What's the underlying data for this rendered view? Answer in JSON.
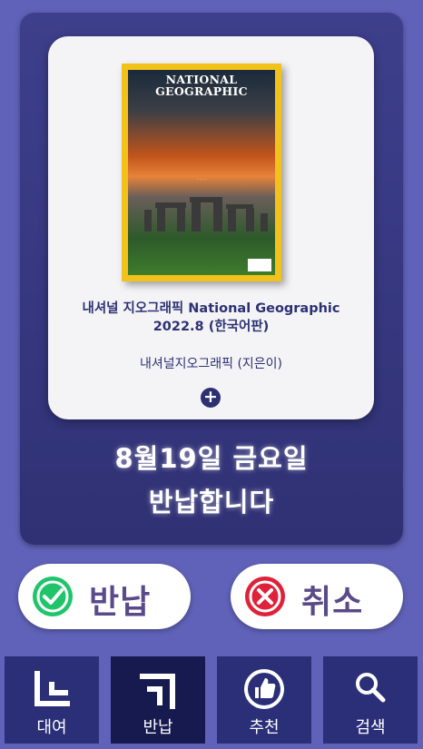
{
  "book": {
    "cover_brand": "NATIONAL\nGEOGRAPHIC",
    "title_line1": "내셔널 지오그래픽 National Geographic",
    "title_line2": "2022.8 (한국어판)",
    "author": "내셔널지오그래픽 (지은이)",
    "more_icon": "plus-circle-icon"
  },
  "due": {
    "line1": "8월19일 금요일",
    "line2": "반납합니다"
  },
  "actions": {
    "confirm_label": "반납",
    "confirm_icon": "check-circle-icon",
    "confirm_color": "#1fc46b",
    "cancel_label": "취소",
    "cancel_icon": "x-circle-icon",
    "cancel_color": "#e0213a"
  },
  "nav": {
    "items": [
      {
        "label": "대여",
        "icon": "borrow-icon",
        "active": false
      },
      {
        "label": "반납",
        "icon": "return-icon",
        "active": true
      },
      {
        "label": "추천",
        "icon": "thumbs-up-icon",
        "active": false
      },
      {
        "label": "검색",
        "icon": "search-icon",
        "active": false
      }
    ]
  },
  "colors": {
    "background": "#5f62b8",
    "panel": "#353680",
    "nav": "#2a2f78",
    "nav_active": "#161a4f",
    "text_dark": "#2c3174"
  }
}
